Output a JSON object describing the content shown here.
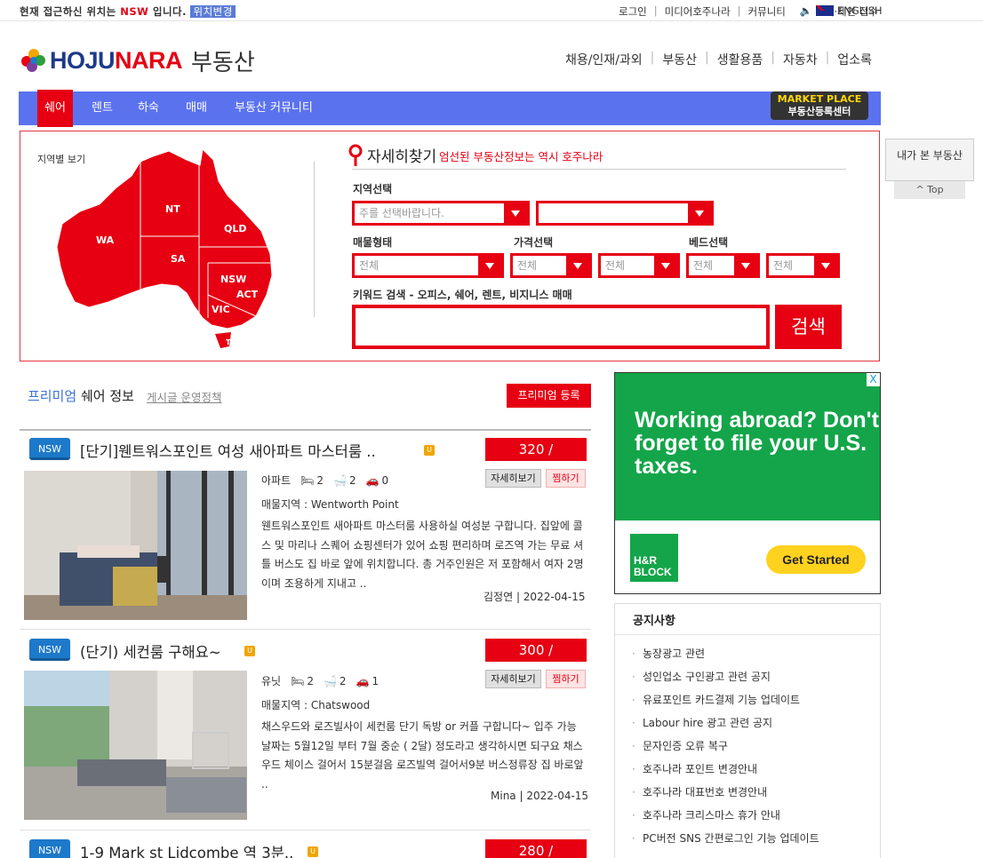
{
  "topbar": {
    "loc_prefix": "현재 접근하신 위치는",
    "loc_region": "NSW",
    "loc_suffix": "입니다.",
    "loc_change": "위치변경",
    "links": [
      "로그인",
      "미디어호주나라",
      "커뮤니티",
      "건의·제안 접수"
    ],
    "english": "ENGLISH"
  },
  "logo": {
    "brand_a": "HOJU",
    "brand_b": "NARA",
    "sub": "부동산"
  },
  "mainnav": [
    "채용/인재/과외",
    "부동산",
    "생활용품",
    "자동차",
    "업소록"
  ],
  "bluenav": {
    "items": [
      "쉐어",
      "렌트",
      "하숙",
      "매매",
      "부동산 커뮤니티"
    ],
    "mp_top": "MARKET PLACE",
    "mp_bottom": "부동산등록센터"
  },
  "search": {
    "map_label": "지역별 보기",
    "regions": [
      "WA",
      "NT",
      "QLD",
      "SA",
      "NSW",
      "ACT",
      "VIC",
      "TAS"
    ],
    "title": "자세히찾기",
    "subtitle": "엄선된 부동산정보는 역시 호주나라",
    "region_label": "지역선택",
    "state_placeholder": "주를 선택바랍니다.",
    "type_label": "매물형태",
    "price_label": "가격선택",
    "bed_label": "베드선택",
    "all": "전체",
    "keyword_label": "키워드 검색 - 오피스, 쉐어, 렌트, 비지니스 매매",
    "search_button": "검색"
  },
  "floating": {
    "recent": "내가 본 부동산",
    "top": "^ Top"
  },
  "premium": {
    "title_blue": "프리미엄",
    "title_rest": "쉐어 정보",
    "policy": "게시글 운영정책",
    "register": "프리미엄 등록"
  },
  "listings": [
    {
      "region": "NSW",
      "title": "[단기]웬트워스포인트 여성 새아파트 마스터룸 ..",
      "price": "320 /",
      "type": "아파트",
      "beds": "2",
      "baths": "2",
      "cars": "0",
      "detail_btn": "자세히보기",
      "save_btn": "찜하기",
      "area": "매물지역 : Wentworth Point",
      "desc": "웬트워스포인트 새아파트 마스터룸 사용하실 여성분 구합니다. 집앞에 콜스 및 마리나 스퀘어 쇼핑센터가 있어 쇼핑 편리하며 로즈역 가는 무료 셔틀 버스도 집 바로 앞에 위치합니다. 총 거주인원은 저 포함해서 여자 2명이며 조용하게 지내고 ..",
      "author": "김정연",
      "date": "2022-04-15"
    },
    {
      "region": "NSW",
      "title": "(단기) 세컨룸 구해요~",
      "price": "300 /",
      "type": "유닛",
      "beds": "2",
      "baths": "2",
      "cars": "1",
      "detail_btn": "자세히보기",
      "save_btn": "찜하기",
      "area": "매물지역 : Chatswood",
      "desc": "채스우드와 로즈빌사이 세컨룸 단기 독방 or 커플 구합니다~ 입주 가능 날짜는 5월12일 부터 7월 중순 ( 2달) 정도라고 생각하시면 되구요 채스우드 체이스 걸어서 15분걸음 로즈빌역 걸어서9분 버스정류장 집 바로앞 ..",
      "author": "Mina",
      "date": "2022-04-15"
    },
    {
      "region": "NSW",
      "title": "1-9 Mark st Lidcombe 역 3분..",
      "price": "280 /"
    }
  ],
  "ad": {
    "headline": "Working abroad? Don't forget to file your U.S. taxes.",
    "brand": "H&R BLOCK",
    "cta": "Get Started",
    "close": "X"
  },
  "notice": {
    "title": "공지사항",
    "items": [
      "농장광고 관련",
      "성인업소 구인광고 관련 공지",
      "유료포인트 카드결제 기능 업데이트",
      "Labour hire 광고 관련 공지",
      "문자인증 오류 복구",
      "호주나라 포인트 변경안내",
      "호주나라 대표번호 변경안내",
      "호주나라 크리스마스 휴가 안내",
      "PC버전 SNS 간편로그인 기능 업데이트"
    ]
  },
  "colors": {
    "brand_red": "#e60012",
    "nav_blue": "#5b72ef",
    "nsw_blue": "#1d79c9",
    "ad_green": "#14a54a"
  }
}
